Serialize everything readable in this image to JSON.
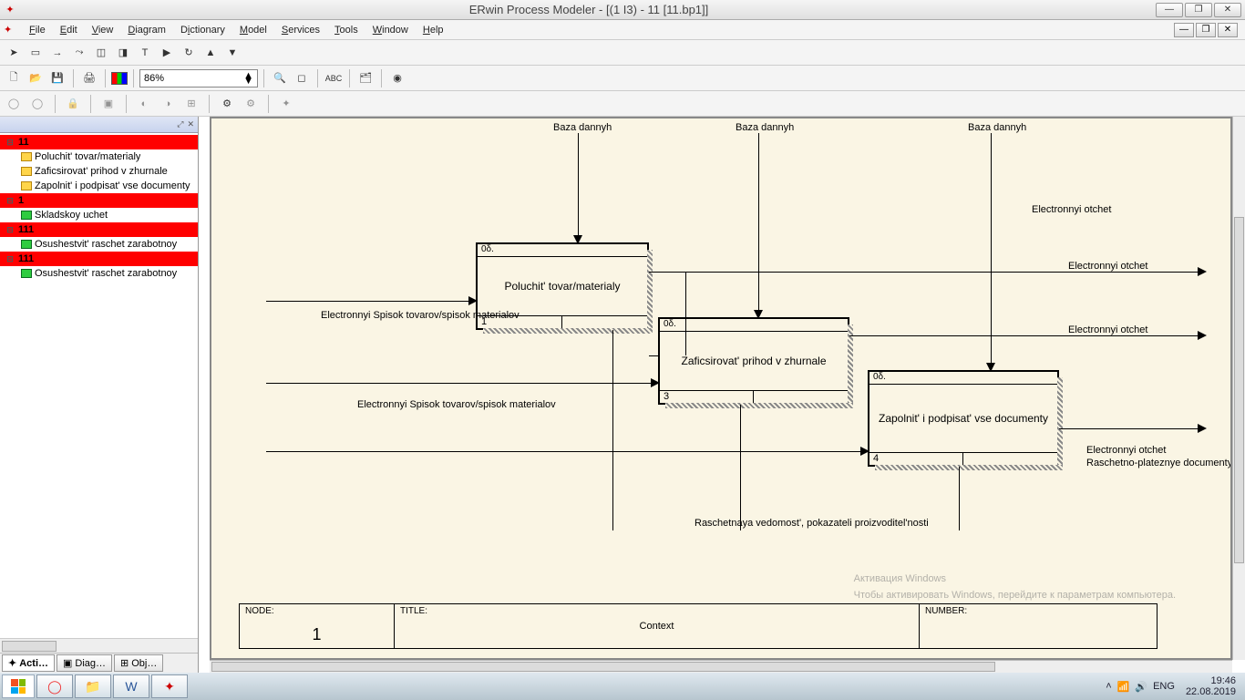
{
  "window": {
    "title": "ERwin Process Modeler - [(1 I3)  -  11  [11.bp1]]",
    "min": "—",
    "max": "❐",
    "close": "✕"
  },
  "menu": [
    "File",
    "Edit",
    "View",
    "Diagram",
    "Dictionary",
    "Model",
    "Services",
    "Tools",
    "Window",
    "Help"
  ],
  "toolbar2": {
    "zoom": "86%"
  },
  "dock": {
    "tabs": [
      "Acti…",
      "Diag…",
      "Obj…"
    ],
    "tree": [
      {
        "type": "group",
        "label": "11"
      },
      {
        "type": "child",
        "icon": "y",
        "label": "Poluchit' tovar/materialy"
      },
      {
        "type": "child",
        "icon": "y",
        "label": "Zaficsirovat' prihod v zhurnale"
      },
      {
        "type": "child",
        "icon": "y",
        "label": "Zapolnit' i podpisat' vse documenty"
      },
      {
        "type": "group",
        "label": "1"
      },
      {
        "type": "child",
        "icon": "g",
        "label": "Skladskoy uchet"
      },
      {
        "type": "group",
        "label": "111"
      },
      {
        "type": "child",
        "icon": "g",
        "label": "Osushestvit' raschet  zarabotnoy"
      },
      {
        "type": "group",
        "label": "111"
      },
      {
        "type": "child",
        "icon": "g",
        "label": "Osushestvit' raschet  zarabotnoy"
      }
    ]
  },
  "diagram": {
    "controls_top": [
      "Baza dannyh",
      "Baza dannyh",
      "Baza dannyh"
    ],
    "arrows_text": {
      "in1": "Electronnyi Spisok tovarov/spisok materialov",
      "in2": "Electronnyi Spisok tovarov/spisok materialov",
      "out1": "Electronnyi otchet",
      "out2": "Electronnyi otchet",
      "out3": "Electronnyi otchet",
      "out4a": "Electronnyi otchet",
      "out4b": "Raschetno-plateznye documenty",
      "mech": "Raschetnaya vedomost', pokazateli proizvoditel'nosti"
    },
    "boxes": [
      {
        "strip": "0δ.",
        "title": "Poluchit' tovar/materialy",
        "num": "1"
      },
      {
        "strip": "0δ.",
        "title": "Zaficsirovat' prihod v zhurnale",
        "num": "3"
      },
      {
        "strip": "0δ.",
        "title": "Zapolnit' i podpisat' vse documenty",
        "num": "4"
      }
    ],
    "footer": {
      "node_cap": "NODE:",
      "node_val": "1",
      "title_cap": "TITLE:",
      "title_val": "Context",
      "number_cap": "NUMBER:"
    },
    "watermark": {
      "h": "Активация Windows",
      "s": "Чтобы активировать Windows, перейдите к параметрам компьютера."
    }
  },
  "taskbar": {
    "lang": "ENG",
    "time": "19:46",
    "date": "22.08.2019"
  }
}
